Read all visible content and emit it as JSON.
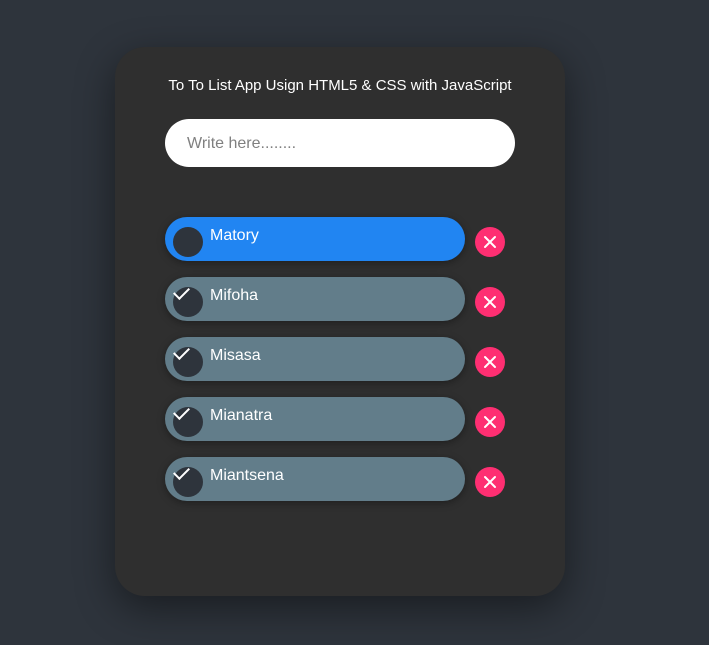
{
  "header": {
    "title": "To To List App Usign HTML5 & CSS with JavaScript"
  },
  "input": {
    "placeholder": "Write here........",
    "value": ""
  },
  "todos": [
    {
      "label": "Matory",
      "checked": false,
      "active": true
    },
    {
      "label": "Mifoha",
      "checked": true,
      "active": false
    },
    {
      "label": "Misasa",
      "checked": true,
      "active": false
    },
    {
      "label": "Mianatra",
      "checked": true,
      "active": false
    },
    {
      "label": "Miantsena",
      "checked": true,
      "active": false
    }
  ],
  "icons": {
    "checkbox": "check-icon",
    "delete": "close-icon"
  },
  "colors": {
    "background": "#2e343c",
    "card": "#2f2f2f",
    "item": "#627d8a",
    "active_item": "#2185f2",
    "delete": "#fe2f72"
  }
}
